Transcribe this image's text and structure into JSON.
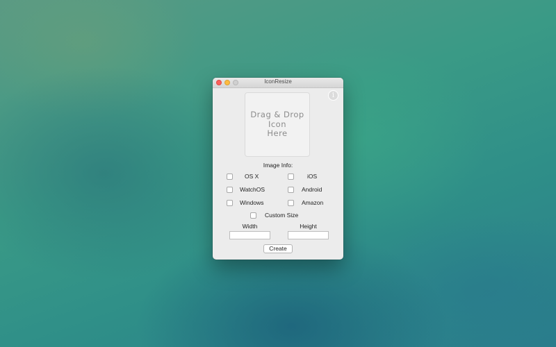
{
  "window": {
    "title": "IconResize"
  },
  "dropzone": {
    "text": "Drag & Drop\nIcon\nHere"
  },
  "icons": {
    "info": "info-icon",
    "info_glyph": "i"
  },
  "image_info": {
    "label": "Image Info:",
    "platforms": [
      {
        "label": "OS X",
        "checked": false
      },
      {
        "label": "iOS",
        "checked": false
      },
      {
        "label": "WatchOS",
        "checked": false
      },
      {
        "label": "Android",
        "checked": false
      },
      {
        "label": "Windows",
        "checked": false
      },
      {
        "label": "Amazon",
        "checked": false
      }
    ],
    "custom_size": {
      "label": "Custom Size",
      "checked": false
    }
  },
  "size_fields": {
    "width_label": "Width",
    "width_value": "",
    "height_label": "Height",
    "height_value": ""
  },
  "actions": {
    "create_label": "Create"
  },
  "colors": {
    "close": "#fc605b",
    "minimize": "#fdbc40",
    "maximize_disabled": "#d0d0d0",
    "window_bg": "#ececec"
  }
}
